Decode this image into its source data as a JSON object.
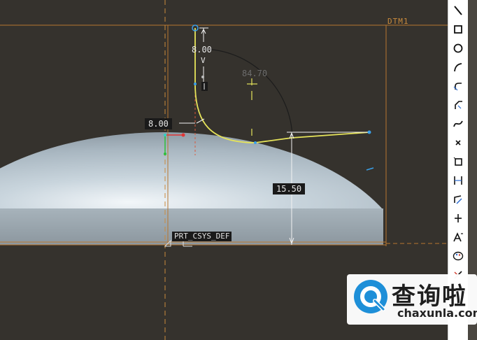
{
  "viewport": {
    "datum_plane_label": "DTM1",
    "csys_label": "PRT_CSYS_DEF",
    "dimensions": {
      "top_length": "8.00",
      "top_v_marker": "V",
      "angle_ghost": "84.70",
      "horizontal_offset": "8.00",
      "vertical_height": "15.50"
    }
  },
  "toolbar": {
    "tools": [
      {
        "icon": "line-icon"
      },
      {
        "icon": "rectangle-icon"
      },
      {
        "icon": "circle-icon"
      },
      {
        "icon": "arc-icon"
      },
      {
        "icon": "fillet-icon"
      },
      {
        "icon": "chamfer-icon"
      },
      {
        "icon": "spline-icon"
      },
      {
        "icon": "point-icon"
      },
      {
        "icon": "offset-edge-icon"
      },
      {
        "icon": "dimension-icon"
      },
      {
        "icon": "modify-icon"
      },
      {
        "icon": "constraint-icon"
      },
      {
        "icon": "text-icon"
      },
      {
        "icon": "palette-icon"
      },
      {
        "icon": "trim-icon"
      },
      {
        "icon": "mirror-icon"
      },
      {
        "icon": "close-icon"
      }
    ]
  },
  "watermark": {
    "brand_cn": "查询啦",
    "brand_en": "chaxunla.com"
  },
  "colors": {
    "background": "#35322d",
    "sketch": "#e6e45a",
    "datum": "#b8762f",
    "dimension_text": "#e8e8e8",
    "watermark_accent": "#1e8fd8",
    "close_button": "#e0262c"
  }
}
